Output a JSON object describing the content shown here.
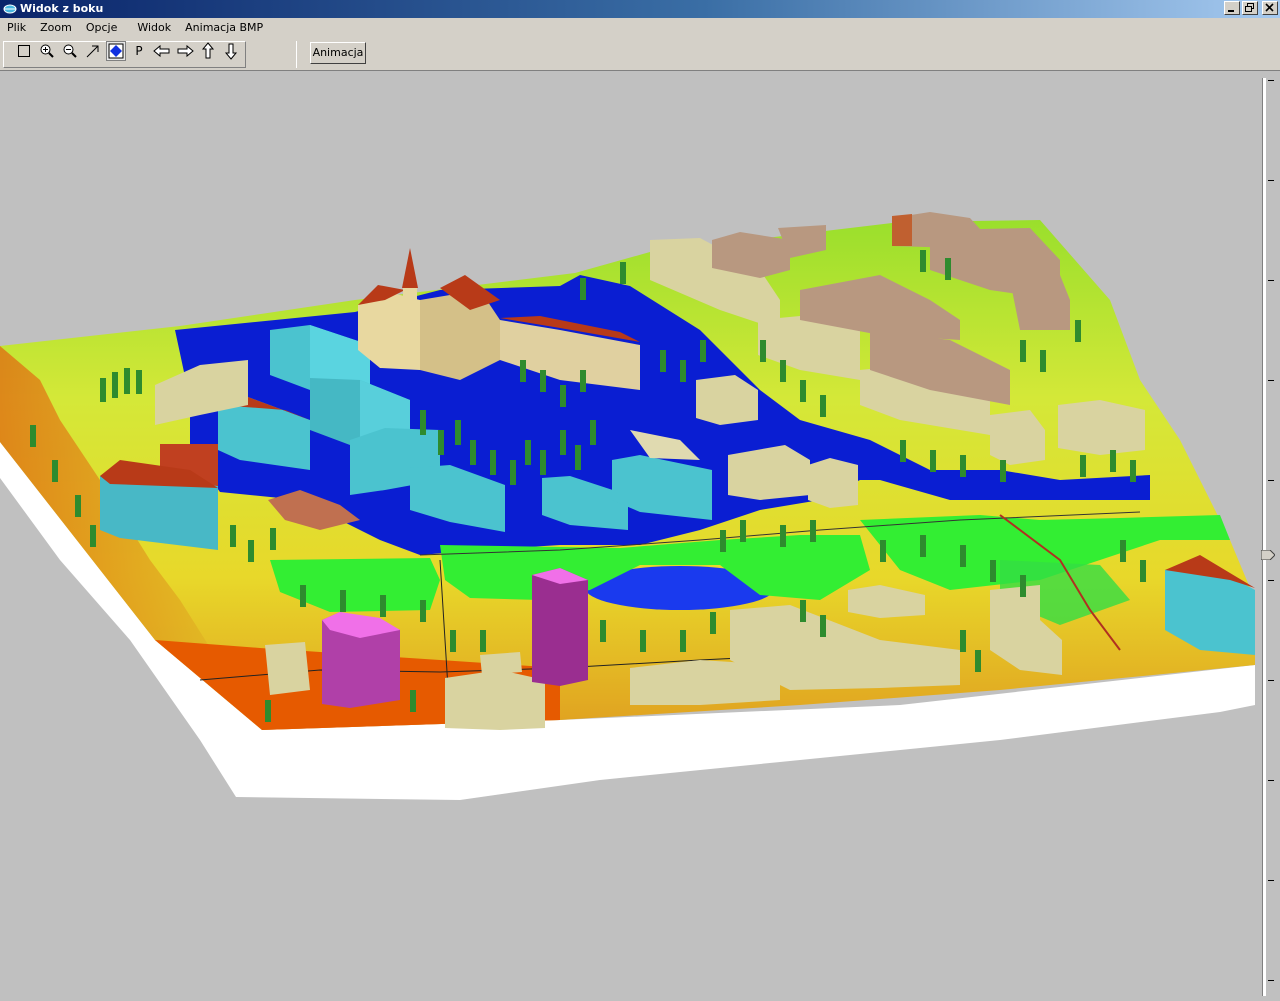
{
  "window": {
    "title": "Widok z boku",
    "icon": "app-globe-icon",
    "controls": [
      "minimize",
      "restore",
      "close"
    ]
  },
  "menu": {
    "items": [
      "Plik",
      "Zoom",
      "Opcje",
      "Widok",
      "Animacja BMP"
    ]
  },
  "toolbar": {
    "tools": [
      {
        "name": "select-rect-icon"
      },
      {
        "name": "zoom-in-icon"
      },
      {
        "name": "zoom-out-icon"
      },
      {
        "name": "arrow-tool-icon"
      },
      {
        "name": "view-3d-icon",
        "active": true
      },
      {
        "name": "p-tool",
        "label": "P"
      },
      {
        "name": "pan-left-icon"
      },
      {
        "name": "pan-right-icon"
      },
      {
        "name": "pan-up-icon"
      },
      {
        "name": "pan-down-icon"
      }
    ],
    "animation_button": "Animacja"
  },
  "colors": {
    "background": "#c0c0c0",
    "water": "#0a1ed2",
    "terrain_low": "#e65a00",
    "terrain_mid": "#e8e02a",
    "terrain_high": "#9adf2c",
    "grass": "#33ee33",
    "building_tan": "#d9d3a0",
    "building_brown": "#b89880",
    "building_cyan": "#4bc3cf",
    "building_magenta": "#b040a8",
    "roof_red": "#b83a18",
    "tree": "#2e8b2e"
  }
}
